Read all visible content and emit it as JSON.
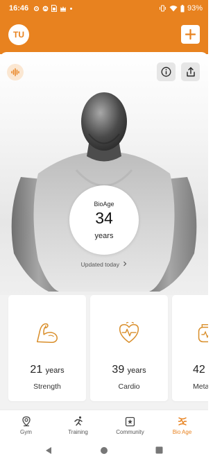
{
  "status_bar": {
    "time": "16:46",
    "battery": "93%",
    "left_icons": [
      "settings-icon",
      "motorola-icon",
      "sim-icon",
      "crown-icon",
      "dot-icon"
    ],
    "right_icons": [
      "vibrate-icon",
      "wifi-icon",
      "battery-icon"
    ]
  },
  "header": {
    "avatar_initials": "TU",
    "add_icon": "plus-icon",
    "background_color": "#e8821f"
  },
  "hero": {
    "label": "BioAge",
    "value": "34",
    "unit": "years",
    "updated": "Updated today",
    "icons": [
      "soundwave-icon",
      "info-icon",
      "share-icon"
    ]
  },
  "metrics": [
    {
      "value": "21",
      "unit": "years",
      "label": "Strength",
      "icon": "flexed-arm-icon"
    },
    {
      "value": "39",
      "unit": "years",
      "label": "Cardio",
      "icon": "heart-pulse-icon"
    },
    {
      "value": "42",
      "unit": "",
      "label": "Meta",
      "icon": "metabolism-icon"
    }
  ],
  "bottom_nav": {
    "items": [
      {
        "label": "Gym",
        "icon": "location-pin-icon",
        "active": false
      },
      {
        "label": "Training",
        "icon": "runner-icon",
        "active": false
      },
      {
        "label": "Community",
        "icon": "community-icon",
        "active": false
      },
      {
        "label": "Bio Age",
        "icon": "bioage-icon",
        "active": true
      }
    ]
  },
  "colors": {
    "accent": "#e8821f",
    "card_background": "#f2f2f2",
    "text": "#222222"
  }
}
